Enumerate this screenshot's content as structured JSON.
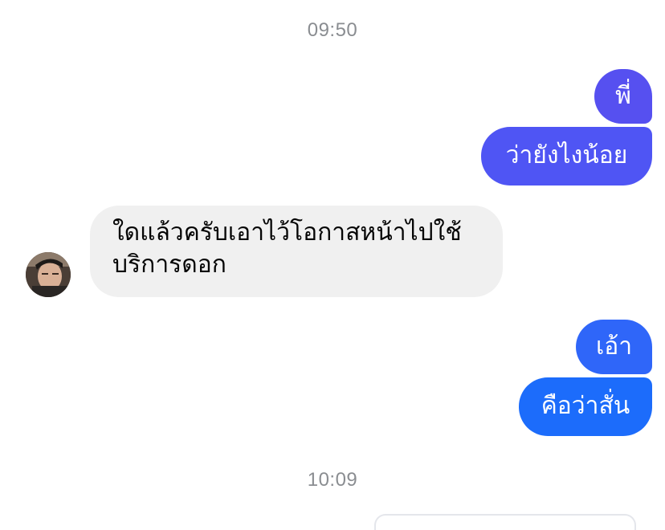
{
  "thread": {
    "timestamp_1": "09:50",
    "timestamp_2": "10:09",
    "messages": [
      {
        "sender": "me",
        "text": "พี่",
        "color": "#5650f0"
      },
      {
        "sender": "me",
        "text": "ว่ายังไงน้อย",
        "color": "#4f55f4"
      },
      {
        "sender": "them",
        "text": "ใดแล้วครับเอาไว้โอกาสหน้าไปใช้บริการดอก"
      },
      {
        "sender": "me",
        "text": "เอ้า",
        "color": "#2f66f9"
      },
      {
        "sender": "me",
        "text": "คือว่าสั่น",
        "color": "#1c6cfb"
      }
    ]
  },
  "colors": {
    "incoming_bubble": "#f0f0f0",
    "timestamp_text": "#8a8d91"
  }
}
